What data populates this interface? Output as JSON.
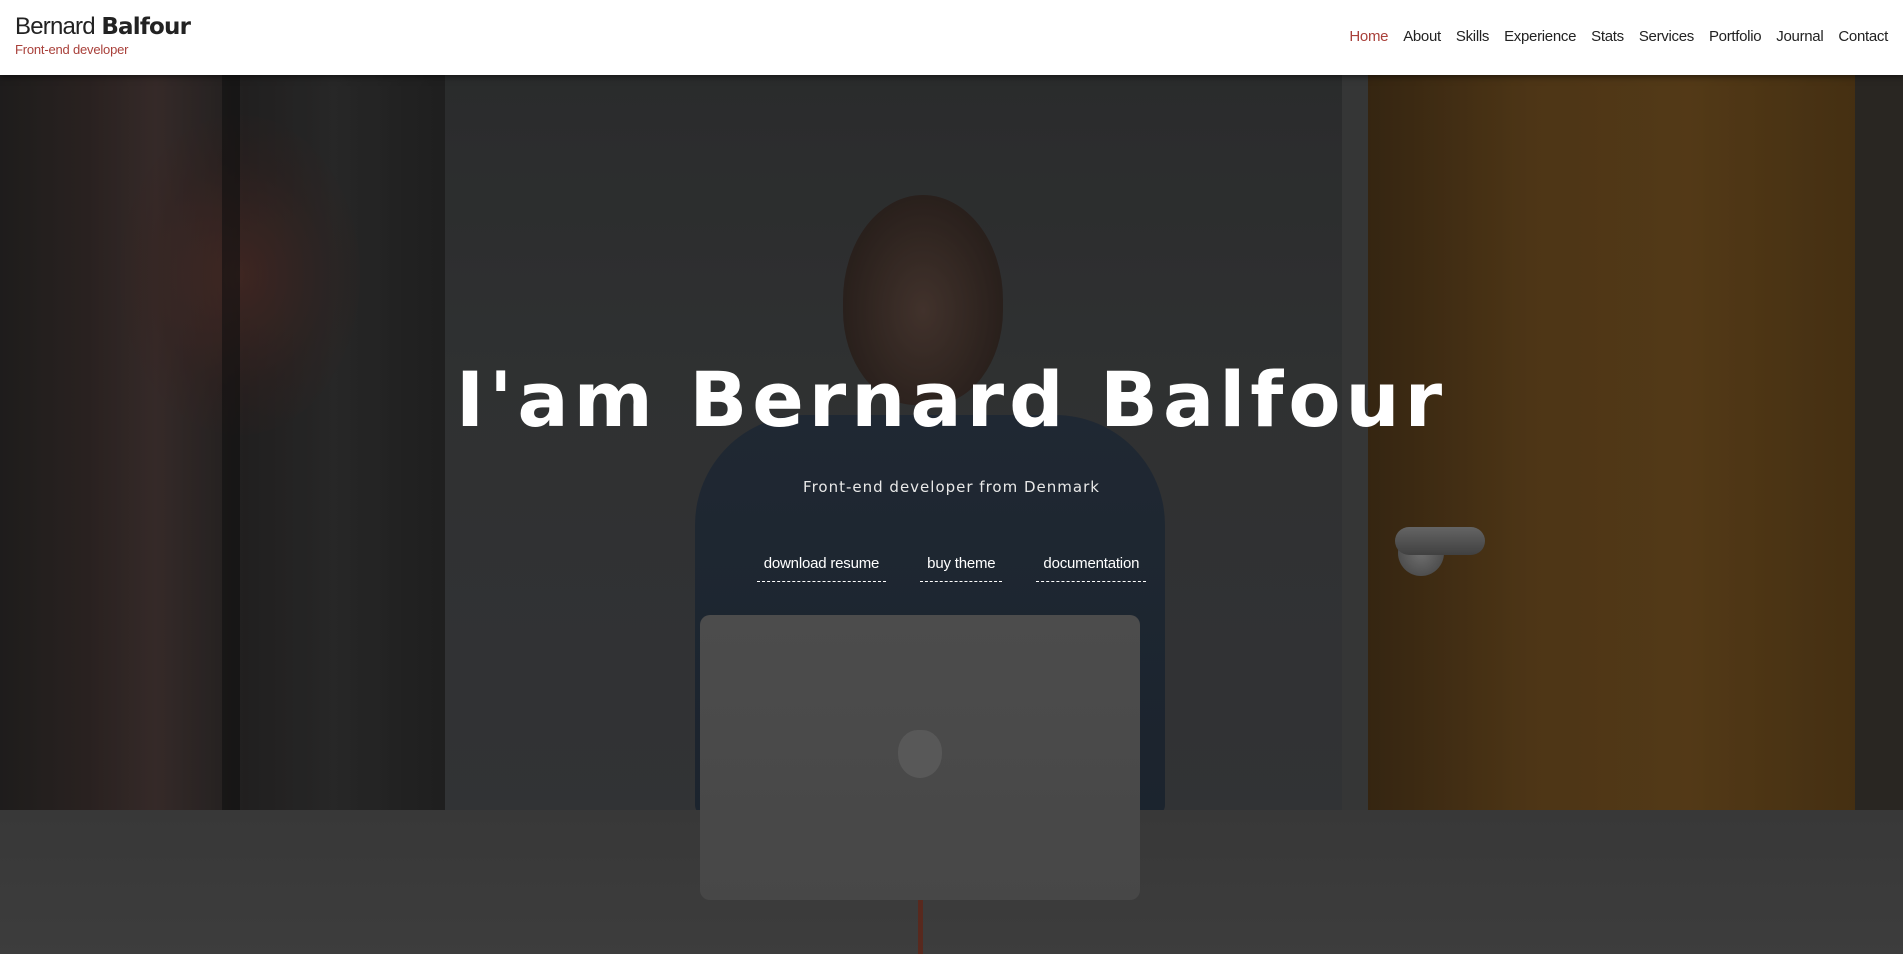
{
  "header": {
    "brand_first": "Bernard",
    "brand_last": "Balfour",
    "brand_subtitle": "Front-end developer"
  },
  "nav": {
    "items": [
      "Home",
      "About",
      "Skills",
      "Experience",
      "Stats",
      "Services",
      "Portfolio",
      "Journal",
      "Contact"
    ],
    "active": "Home"
  },
  "hero": {
    "title": "I'am Bernard Balfour",
    "subtitle": "Front-end developer from Denmark",
    "buttons": [
      "download resume",
      "buy theme",
      "documentation"
    ]
  },
  "colors": {
    "accent": "#a9403a",
    "header_bg": "#ffffff",
    "hero_text": "#ffffff"
  }
}
